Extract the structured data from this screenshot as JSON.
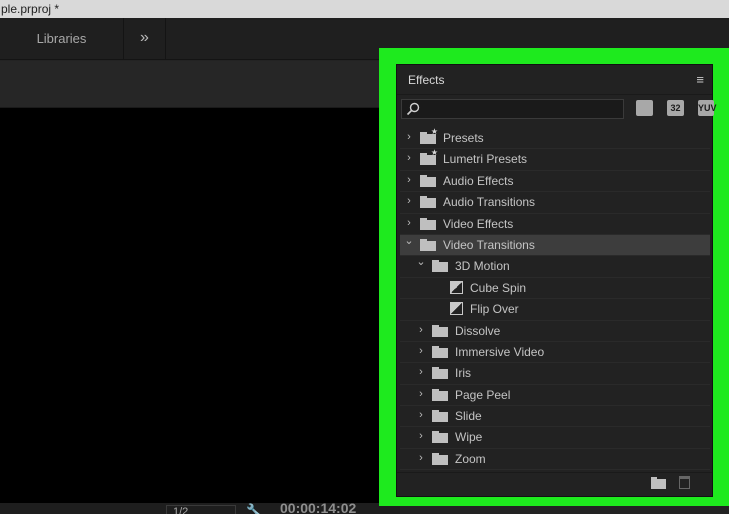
{
  "window": {
    "title": "ple.prproj *"
  },
  "tabbar": {
    "libraries": "Libraries",
    "overflow": "»"
  },
  "monitor": {
    "zoom": "1/2",
    "timecode": "00:00:14:02"
  },
  "effects": {
    "title": "Effects",
    "menu": "≡",
    "search": {
      "value": "",
      "placeholder": ""
    },
    "filters": [
      "",
      "32",
      "YUV"
    ],
    "tree": [
      {
        "label": "Presets",
        "level": 0,
        "expanded": false,
        "type": "preset-folder"
      },
      {
        "label": "Lumetri Presets",
        "level": 0,
        "expanded": false,
        "type": "preset-folder"
      },
      {
        "label": "Audio Effects",
        "level": 0,
        "expanded": false,
        "type": "folder"
      },
      {
        "label": "Audio Transitions",
        "level": 0,
        "expanded": false,
        "type": "folder"
      },
      {
        "label": "Video Effects",
        "level": 0,
        "expanded": false,
        "type": "folder"
      },
      {
        "label": "Video Transitions",
        "level": 0,
        "expanded": true,
        "type": "folder",
        "selected": true
      },
      {
        "label": "3D Motion",
        "level": 1,
        "expanded": true,
        "type": "folder"
      },
      {
        "label": "Cube Spin",
        "level": 2,
        "type": "transition"
      },
      {
        "label": "Flip Over",
        "level": 2,
        "type": "transition"
      },
      {
        "label": "Dissolve",
        "level": 1,
        "expanded": false,
        "type": "folder"
      },
      {
        "label": "Immersive Video",
        "level": 1,
        "expanded": false,
        "type": "folder"
      },
      {
        "label": "Iris",
        "level": 1,
        "expanded": false,
        "type": "folder"
      },
      {
        "label": "Page Peel",
        "level": 1,
        "expanded": false,
        "type": "folder"
      },
      {
        "label": "Slide",
        "level": 1,
        "expanded": false,
        "type": "folder"
      },
      {
        "label": "Wipe",
        "level": 1,
        "expanded": false,
        "type": "folder"
      },
      {
        "label": "Zoom",
        "level": 1,
        "expanded": false,
        "type": "folder"
      }
    ]
  },
  "colors": {
    "highlight_frame": "#1eea1e",
    "panel_bg": "#222222",
    "selected_row": "#3d3d3d"
  }
}
